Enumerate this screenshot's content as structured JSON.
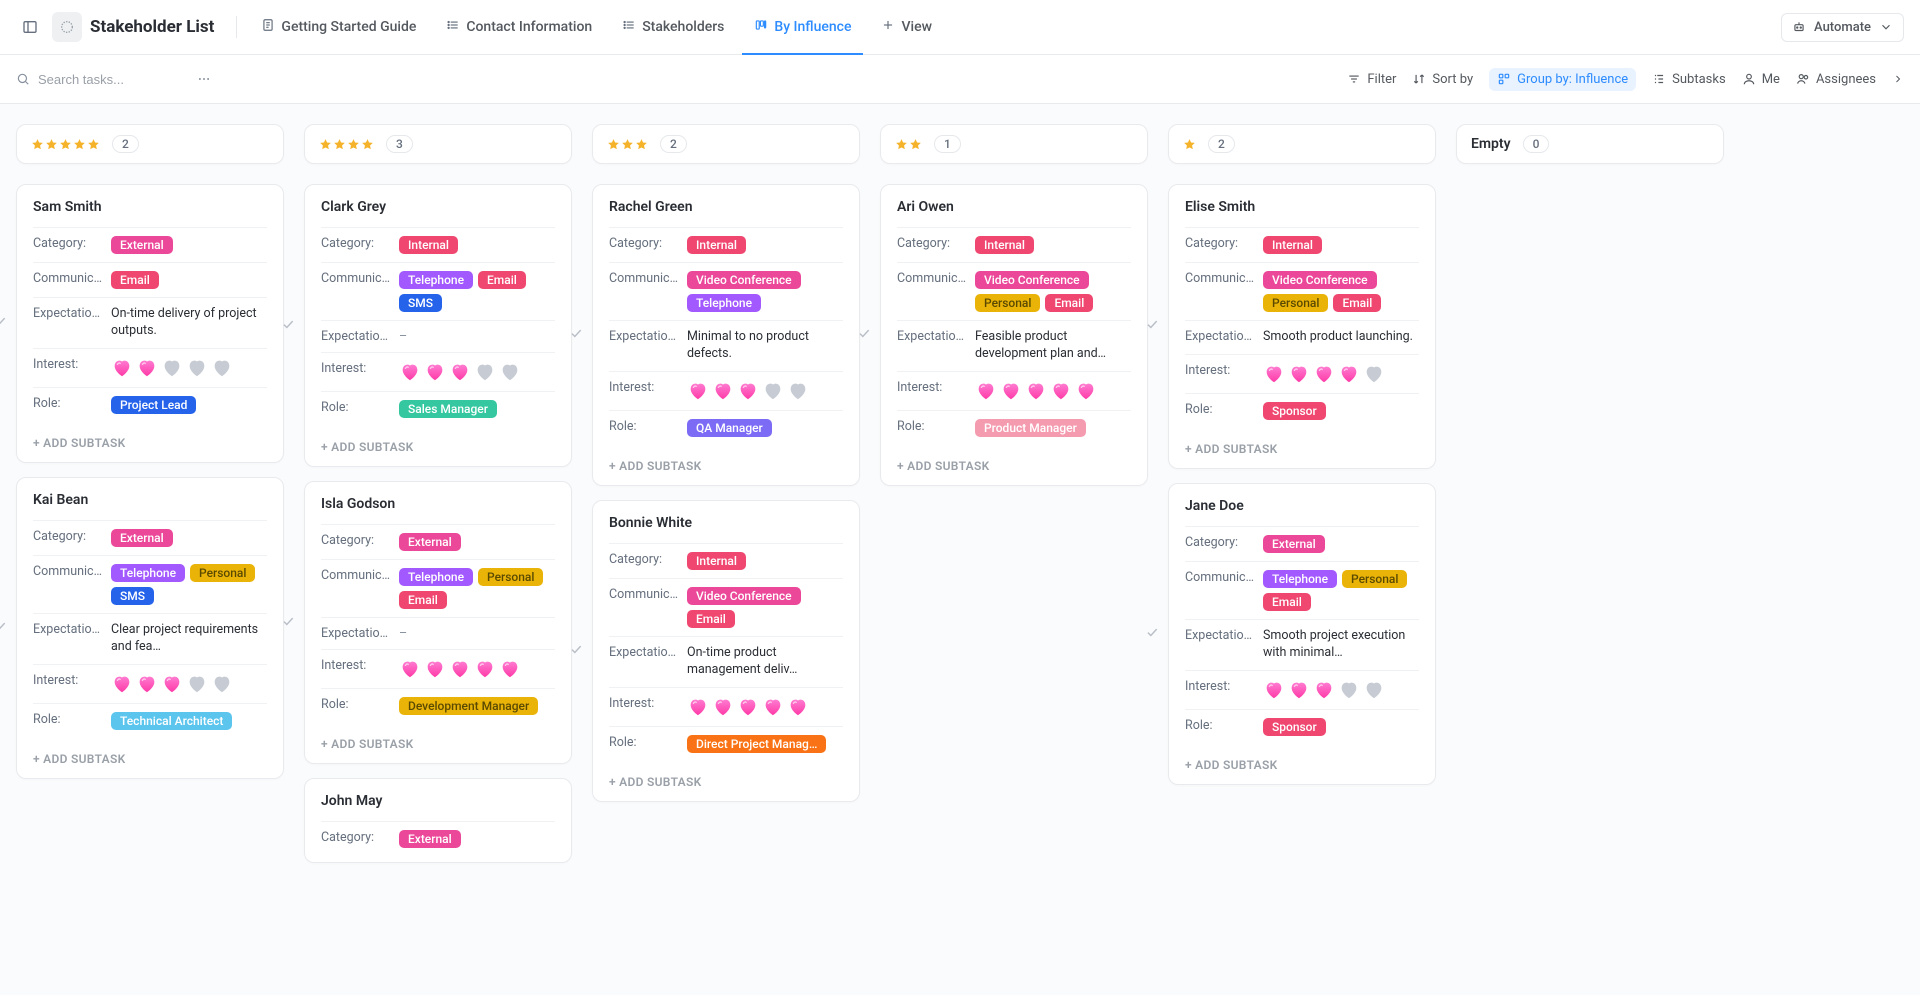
{
  "header": {
    "title": "Stakeholder List",
    "tabs": [
      {
        "label": "Getting Started Guide",
        "icon": "doc",
        "active": false
      },
      {
        "label": "Contact Information",
        "icon": "list",
        "active": false
      },
      {
        "label": "Stakeholders",
        "icon": "list",
        "active": false
      },
      {
        "label": "By Influence",
        "icon": "board",
        "active": true
      },
      {
        "label": "View",
        "icon": "plus",
        "active": false
      }
    ],
    "automate_label": "Automate"
  },
  "toolbar": {
    "search_placeholder": "Search tasks...",
    "filter_label": "Filter",
    "sortby_label": "Sort by",
    "groupby_label": "Group by: Influence",
    "subtasks_label": "Subtasks",
    "me_label": "Me",
    "assignees_label": "Assignees"
  },
  "field_labels": {
    "category": "Category:",
    "communication": "Communic…",
    "expectation": "Expectatio…",
    "interest": "Interest:",
    "role": "Role:"
  },
  "add_subtask_label": "+ ADD SUBTASK",
  "tag_colors": {
    "External": "#ec4899",
    "Internal": "#ef4770",
    "Email": "#ef4770",
    "Telephone": "#a259ff",
    "SMS": "#2563eb",
    "Personal": "#eab308",
    "Video Conference": "#ec4899",
    "Project Lead": "#2563eb",
    "Sales Manager": "#34c7a0",
    "Technical Architect": "#5bc5ee",
    "Development Manager": "#eab308",
    "QA Manager": "#7c6cf5",
    "Direct Project Manag…": "#f97316",
    "Product Manager": "#f59bb0",
    "Sponsor": "#ef4770"
  },
  "columns": [
    {
      "stars": 5,
      "count": "2",
      "cards": [
        {
          "name": "Sam Smith",
          "check": true,
          "category": [
            "External"
          ],
          "comm": [
            "Email"
          ],
          "expect": "On-time delivery of project outputs.",
          "interest": 2,
          "role": [
            "Project Lead"
          ]
        },
        {
          "name": "Kai Bean",
          "check": true,
          "category": [
            "External"
          ],
          "comm": [
            "Telephone",
            "Personal",
            "SMS"
          ],
          "expect": "Clear project requirements and fea…",
          "interest": 3,
          "role": [
            "Technical Architect"
          ]
        }
      ]
    },
    {
      "stars": 4,
      "count": "3",
      "cards": [
        {
          "name": "Clark Grey",
          "check": true,
          "category": [
            "Internal"
          ],
          "comm": [
            "Telephone",
            "Email",
            "SMS"
          ],
          "expect": "–",
          "interest": 3,
          "role": [
            "Sales Manager"
          ]
        },
        {
          "name": "Isla Godson",
          "check": true,
          "category": [
            "External"
          ],
          "comm": [
            "Telephone",
            "Personal",
            "Email"
          ],
          "expect": "–",
          "interest": 5,
          "role": [
            "Development Manager"
          ]
        },
        {
          "name": "John May",
          "check": false,
          "partial": true,
          "category": [
            "External"
          ]
        }
      ]
    },
    {
      "stars": 3,
      "count": "2",
      "cards": [
        {
          "name": "Rachel Green",
          "check": true,
          "category": [
            "Internal"
          ],
          "comm": [
            "Video Conference",
            "Telephone"
          ],
          "expect": "Minimal to no product defects.",
          "interest": 3,
          "role": [
            "QA Manager"
          ]
        },
        {
          "name": "Bonnie White",
          "check": true,
          "category": [
            "Internal"
          ],
          "comm": [
            "Video Conference",
            "Email"
          ],
          "expect": "On-time product management deliv…",
          "interest": 5,
          "role": [
            "Direct Project Manag…"
          ]
        }
      ]
    },
    {
      "stars": 2,
      "count": "1",
      "cards": [
        {
          "name": "Ari Owen",
          "check": true,
          "category": [
            "Internal"
          ],
          "comm": [
            "Video Conference",
            "Personal",
            "Email"
          ],
          "expect": "Feasible product development plan and…",
          "interest": 5,
          "role": [
            "Product Manager"
          ]
        }
      ]
    },
    {
      "stars": 1,
      "count": "2",
      "cards": [
        {
          "name": "Elise Smith",
          "check": true,
          "category": [
            "Internal"
          ],
          "comm": [
            "Video Conference",
            "Personal",
            "Email"
          ],
          "expect": "Smooth product launching.",
          "interest": 4,
          "role": [
            "Sponsor"
          ]
        },
        {
          "name": "Jane Doe",
          "check": true,
          "category": [
            "External"
          ],
          "comm": [
            "Telephone",
            "Personal",
            "Email"
          ],
          "expect": "Smooth project execution with minimal…",
          "interest": 3,
          "role": [
            "Sponsor"
          ]
        }
      ]
    },
    {
      "stars": 0,
      "count": "0",
      "empty_label": "Empty",
      "cards": []
    }
  ]
}
